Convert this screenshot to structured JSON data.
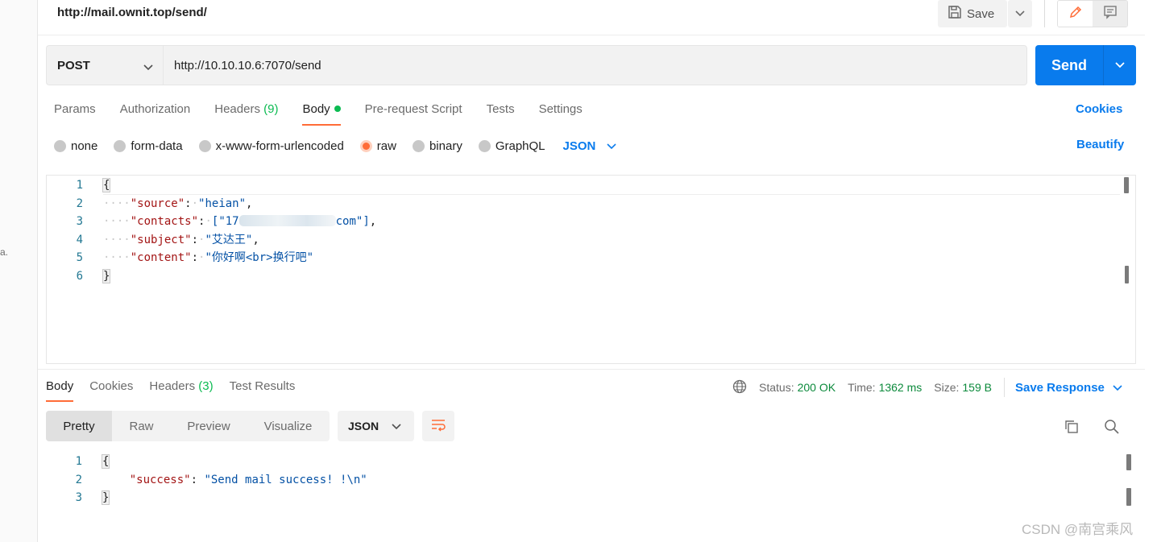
{
  "left_panel": {
    "fragment": "a."
  },
  "request": {
    "title": "http://mail.ownit.top/send/",
    "save_label": "Save",
    "method": "POST",
    "url": "http://10.10.10.6:7070/send",
    "send_label": "Send"
  },
  "request_tabs": [
    {
      "label": "Params"
    },
    {
      "label": "Authorization"
    },
    {
      "label": "Headers",
      "count": "(9)"
    },
    {
      "label": "Body",
      "active": true
    },
    {
      "label": "Pre-request Script"
    },
    {
      "label": "Tests"
    },
    {
      "label": "Settings"
    }
  ],
  "cookies_label": "Cookies",
  "body_types": [
    {
      "label": "none"
    },
    {
      "label": "form-data"
    },
    {
      "label": "x-www-form-urlencoded"
    },
    {
      "label": "raw",
      "checked": true
    },
    {
      "label": "binary"
    },
    {
      "label": "GraphQL"
    }
  ],
  "body_language": "JSON",
  "beautify_label": "Beautify",
  "request_body": {
    "line_numbers": [
      "1",
      "2",
      "3",
      "4",
      "5",
      "6"
    ],
    "open_brace": "{",
    "close_brace": "}",
    "source_key": "\"source\"",
    "source_value": "\"heian\"",
    "contacts_key": "\"contacts\"",
    "contacts_value_start": "[\"17",
    "contacts_value_end": "com\"]",
    "subject_key": "\"subject\"",
    "subject_value": "\"艾达王\"",
    "content_key": "\"content\"",
    "content_value": "\"你好啊<br>换行吧\""
  },
  "response_tabs": [
    {
      "label": "Body",
      "active": true
    },
    {
      "label": "Cookies"
    },
    {
      "label": "Headers",
      "count": "(3)"
    },
    {
      "label": "Test Results"
    }
  ],
  "response_status": {
    "status_label": "Status:",
    "status_value": "200 OK",
    "time_label": "Time:",
    "time_value": "1362 ms",
    "size_label": "Size:",
    "size_value": "159 B",
    "save_response_label": "Save Response"
  },
  "view_modes": [
    {
      "label": "Pretty",
      "active": true
    },
    {
      "label": "Raw"
    },
    {
      "label": "Preview"
    },
    {
      "label": "Visualize"
    }
  ],
  "response_language": "JSON",
  "response_body": {
    "line_numbers": [
      "1",
      "2",
      "3"
    ],
    "open_brace": "{",
    "close_brace": "}",
    "success_key": "\"success\"",
    "success_value": "\"Send mail success! !\\n\""
  },
  "watermark": "CSDN @南宫乘风",
  "colors": {
    "accent_orange": "#ff6c37",
    "primary_blue": "#097bed",
    "success_green": "#0cbb52",
    "json_key": "#a31515",
    "json_string": "#0451a5"
  },
  "icons": {
    "save": "save-icon",
    "edit": "pencil-icon",
    "comments": "comment-icon",
    "globe": "globe-icon",
    "wrap": "wrap-lines-icon",
    "copy": "copy-icon",
    "search": "search-icon"
  }
}
